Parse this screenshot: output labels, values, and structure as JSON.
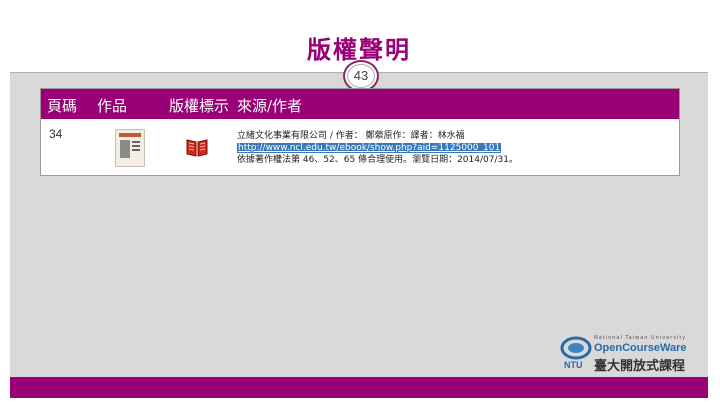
{
  "slide": {
    "title": "版權聲明",
    "page_number": "43"
  },
  "table": {
    "headers": [
      "頁碼",
      "作品",
      "版權標示",
      "來源/作者"
    ],
    "rows": [
      {
        "page": "34",
        "source_lines": [
          "立緒文化事業有限公司 / 作者： 鄭縈原作：譯者：林水福",
          "http://www.ncl.edu.tw/ebook/show.php?aid=1125000_101",
          "依據著作權法第 46、52、65 條合理使用。瀏覽日期：2014/07/31。"
        ]
      }
    ]
  },
  "footer_logo": {
    "small_text": "National Taiwan University",
    "brand": "OpenCourseWare",
    "mark": "NTU",
    "name_zh": "臺大開放式課程"
  },
  "colors": {
    "accent": "#990077",
    "background": "#d9d9d9",
    "link": "#3a7ab8"
  }
}
